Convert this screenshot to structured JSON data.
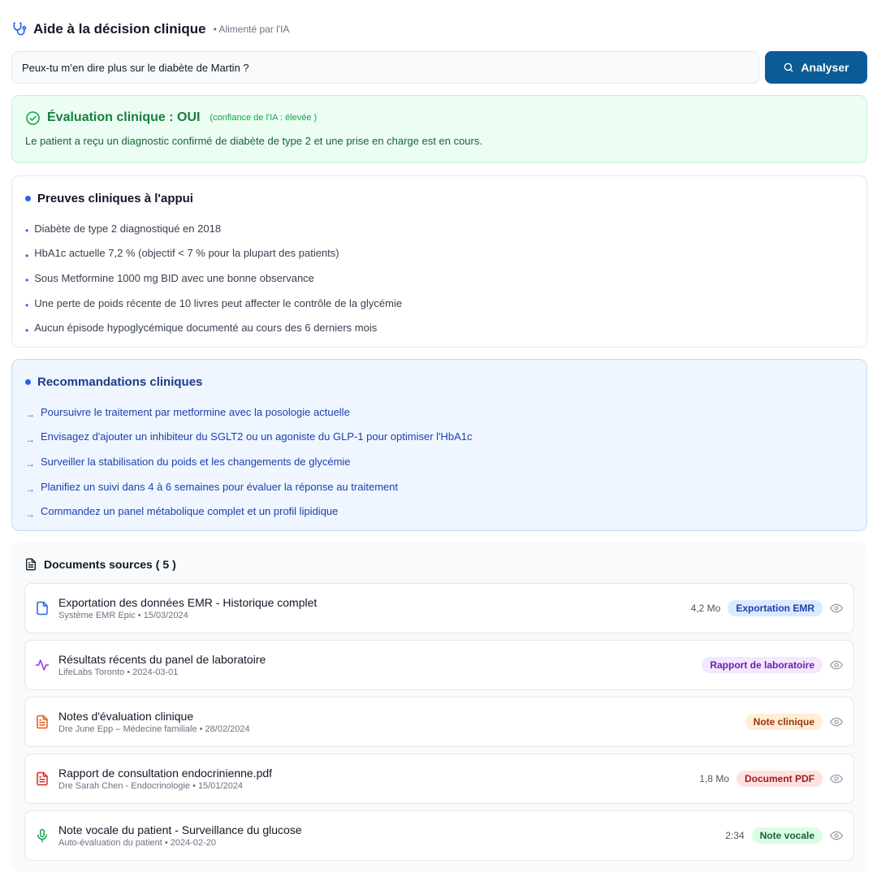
{
  "header": {
    "title": "Aide à la décision clinique",
    "subtitle": "• Alimenté par l'IA"
  },
  "search": {
    "value": "Peux-tu m’en dire plus sur le diabète de Martin ?",
    "button_label": "Analyser"
  },
  "evaluation": {
    "title": "Évaluation clinique : OUI",
    "confidence": "(confiance de l'IA : élevée )",
    "text": "Le patient a reçu un diagnostic confirmé de diabète de type 2 et une prise en charge est en cours."
  },
  "evidence": {
    "title": "Preuves cliniques à l'appui",
    "items": [
      "Diabète de type 2 diagnostiqué en 2018",
      "HbA1c actuelle 7,2 % (objectif < 7 % pour la plupart des patients)",
      "Sous Metformine 1000 mg BID avec une bonne observance",
      "Une perte de poids récente de 10 livres peut affecter le contrôle de la glycémie",
      "Aucun épisode hypoglycémique documenté au cours des 6 derniers mois"
    ]
  },
  "recommendations": {
    "title": "Recommandations cliniques",
    "items": [
      "Poursuivre le traitement par metformine avec la posologie actuelle",
      "Envisagez d'ajouter un inhibiteur du SGLT2 ou un agoniste du GLP-1 pour optimiser l'HbA1c",
      "Surveiller la stabilisation du poids et les changements de glycémie",
      "Planifiez un suivi dans 4 à 6 semaines pour évaluer la réponse au traitement",
      "Commandez un panel métabolique complet et un profil lipidique"
    ]
  },
  "documents": {
    "title": "Documents sources (",
    "count": "5",
    "close": ")",
    "items": [
      {
        "name": "Exportation des données EMR - Historique complet",
        "meta": "Système EMR Epic • 15/03/2024",
        "size": "4,2 Mo",
        "badge": "Exportation EMR",
        "icon": "file-icon",
        "color": "#2563eb",
        "badge_bg": "#dbeafe",
        "badge_fg": "#1e40af"
      },
      {
        "name": "Résultats récents du panel de laboratoire",
        "meta": "LifeLabs Toronto • 2024-03-01",
        "size": "",
        "badge": "Rapport de laboratoire",
        "icon": "activity-icon",
        "color": "#9333ea",
        "badge_bg": "#f3e8ff",
        "badge_fg": "#6b21a8"
      },
      {
        "name": "Notes d'évaluation clinique",
        "meta": "Dre June Epp – Médecine familiale • 28/02/2024",
        "size": "",
        "badge": "Note clinique",
        "icon": "file-text-icon",
        "color": "#ea580c",
        "badge_bg": "#ffedd5",
        "badge_fg": "#9a3412"
      },
      {
        "name": "Rapport de consultation endocrinienne.pdf",
        "meta": "Dre Sarah Chen - Endocrinologie • 15/01/2024",
        "size": "1,8 Mo",
        "badge": "Document PDF",
        "icon": "file-text-icon",
        "color": "#dc2626",
        "badge_bg": "#fee2e2",
        "badge_fg": "#991b1b"
      },
      {
        "name": "Note vocale du patient - Surveillance du glucose",
        "meta": "Auto-évaluation du patient • 2024-02-20",
        "size": "2:34",
        "badge": "Note vocale",
        "icon": "mic-icon",
        "color": "#16a34a",
        "badge_bg": "#dcfce7",
        "badge_fg": "#166534"
      }
    ]
  }
}
